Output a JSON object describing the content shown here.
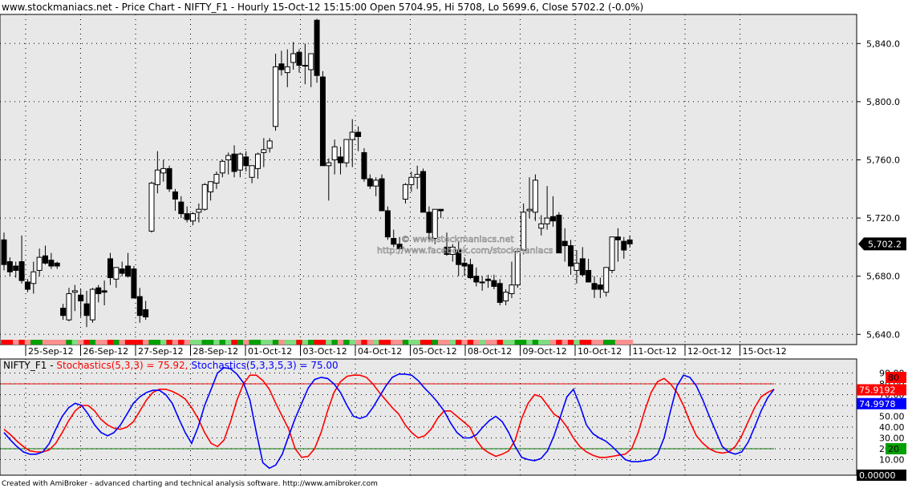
{
  "title": "www.stockmaniacs.net - Price Chart - NIFTY_F1 - Hourly 15-Oct-12 15:15:00 Open 5704.95, Hi 5708, Lo 5699.6, Close 5702.2 (-0.0%)",
  "footer": "Created with AmiBroker - advanced charting and technical analysis software. http://www.amibroker.com",
  "watermark": {
    "line1": "© www.stockmaniacs.net",
    "line2": "http://www.facebook.com/stockmaniacs"
  },
  "colors": {
    "bg": "#e8e8e8",
    "up": "#ffffff",
    "down": "#000000",
    "k_line": "#0000ff",
    "d_line": "#ff0000",
    "overbought": "#ff0000",
    "oversold": "#008000"
  },
  "chart_data": [
    {
      "type": "candlestick",
      "title": "NIFTY_F1 Hourly",
      "ylim": [
        5633,
        5860
      ],
      "y_ticks": [
        5640,
        5680,
        5720,
        5760,
        5800,
        5840
      ],
      "y_tick_labels": [
        "5,640.0",
        "5,680.0",
        "5,720.0",
        "5,760.0",
        "5,800.0",
        "5,840.0"
      ],
      "last_value_label": "5,702.2",
      "last_value": 5702.2,
      "dates": [
        "25-Sep-12",
        "26-Sep-12",
        "27-Sep-12",
        "28-Sep-12",
        "01-Oct-12",
        "03-Oct-12",
        "04-Oct-12",
        "05-Oct-12",
        "08-Oct-12",
        "09-Oct-12",
        "10-Oct-12",
        "11-Oct-12",
        "12-Oct-12",
        "15-Oct-12"
      ],
      "ohlc": [
        [
          5705,
          5710,
          5684,
          5688
        ],
        [
          5690,
          5693,
          5680,
          5683
        ],
        [
          5687,
          5690,
          5679,
          5684
        ],
        [
          5690,
          5708,
          5675,
          5677
        ],
        [
          5676,
          5678,
          5669,
          5671
        ],
        [
          5675,
          5690,
          5668,
          5683
        ],
        [
          5684,
          5699,
          5680,
          5693
        ],
        [
          5694,
          5701,
          5688,
          5689
        ],
        [
          5691,
          5696,
          5685,
          5687
        ],
        [
          5689,
          5690,
          5685,
          5687
        ],
        [
          5658,
          5661,
          5650,
          5653
        ],
        [
          5650,
          5672,
          5649,
          5668
        ],
        [
          5669,
          5674,
          5656,
          5670
        ],
        [
          5667,
          5671,
          5652,
          5663
        ],
        [
          5661,
          5670,
          5645,
          5653
        ],
        [
          5650,
          5672,
          5648,
          5671
        ],
        [
          5672,
          5674,
          5662,
          5668
        ],
        [
          5670,
          5677,
          5660,
          5669
        ],
        [
          5692,
          5696,
          5674,
          5679
        ],
        [
          5678,
          5686,
          5672,
          5686
        ],
        [
          5685,
          5690,
          5680,
          5682
        ],
        [
          5687,
          5696,
          5679,
          5680
        ],
        [
          5685,
          5687,
          5665,
          5665
        ],
        [
          5666,
          5672,
          5648,
          5653
        ],
        [
          5657,
          5663,
          5650,
          5652
        ],
        [
          5711,
          5745,
          5710,
          5744
        ],
        [
          5743,
          5766,
          5737,
          5753
        ],
        [
          5751,
          5760,
          5745,
          5754
        ],
        [
          5754,
          5756,
          5738,
          5740
        ],
        [
          5738,
          5740,
          5725,
          5733
        ],
        [
          5731,
          5735,
          5720,
          5723
        ],
        [
          5723,
          5728,
          5717,
          5719
        ],
        [
          5718,
          5724,
          5715,
          5723
        ],
        [
          5724,
          5730,
          5717,
          5726
        ],
        [
          5726,
          5744,
          5725,
          5743
        ],
        [
          5738,
          5745,
          5732,
          5745
        ],
        [
          5744,
          5752,
          5740,
          5750
        ],
        [
          5751,
          5760,
          5748,
          5759
        ],
        [
          5760,
          5765,
          5750,
          5763
        ],
        [
          5764,
          5770,
          5748,
          5752
        ],
        [
          5753,
          5765,
          5748,
          5764
        ],
        [
          5762,
          5766,
          5752,
          5756
        ],
        [
          5748,
          5755,
          5744,
          5756
        ],
        [
          5754,
          5765,
          5747,
          5764
        ],
        [
          5765,
          5775,
          5755,
          5767
        ],
        [
          5768,
          5775,
          5765,
          5773
        ],
        [
          5783,
          5833,
          5780,
          5824
        ],
        [
          5826,
          5835,
          5818,
          5822
        ],
        [
          5820,
          5836,
          5810,
          5824
        ],
        [
          5827,
          5841,
          5822,
          5833
        ],
        [
          5834,
          5836,
          5820,
          5825
        ],
        [
          5825,
          5840,
          5812,
          5825
        ],
        [
          5822,
          5832,
          5810,
          5833
        ],
        [
          5856,
          5857,
          5813,
          5818
        ],
        [
          5817,
          5821,
          5768,
          5756
        ],
        [
          5756,
          5761,
          5732,
          5758
        ],
        [
          5760,
          5774,
          5750,
          5769
        ],
        [
          5762,
          5769,
          5750,
          5758
        ],
        [
          5758,
          5770,
          5755,
          5774
        ],
        [
          5774,
          5788,
          5755,
          5779
        ],
        [
          5779,
          5783,
          5766,
          5776
        ],
        [
          5765,
          5768,
          5745,
          5747
        ],
        [
          5747,
          5750,
          5740,
          5742
        ],
        [
          5742,
          5748,
          5735,
          5746
        ],
        [
          5747,
          5750,
          5725,
          5725
        ],
        [
          5725,
          5728,
          5705,
          5707
        ],
        [
          5706,
          5712,
          5700,
          5702
        ],
        [
          5702,
          5707,
          5698,
          5699
        ],
        [
          5733,
          5744,
          5730,
          5743
        ],
        [
          5743,
          5752,
          5738,
          5748
        ],
        [
          5748,
          5756,
          5740,
          5750
        ],
        [
          5752,
          5754,
          5724,
          5724
        ],
        [
          5724,
          5728,
          5705,
          5710
        ],
        [
          5706,
          5726,
          5702,
          5726
        ],
        [
          5726,
          5726,
          5720,
          5725
        ],
        [
          5700,
          5710,
          5694,
          5695
        ],
        [
          5695,
          5702,
          5690,
          5700
        ],
        [
          5698,
          5704,
          5680,
          5688
        ],
        [
          5689,
          5693,
          5680,
          5687
        ],
        [
          5688,
          5692,
          5678,
          5679
        ],
        [
          5680,
          5686,
          5673,
          5676
        ],
        [
          5676,
          5680,
          5670,
          5676
        ],
        [
          5678,
          5681,
          5672,
          5677
        ],
        [
          5677,
          5681,
          5671,
          5673
        ],
        [
          5675,
          5678,
          5660,
          5662
        ],
        [
          5663,
          5671,
          5660,
          5669
        ],
        [
          5668,
          5690,
          5665,
          5674
        ],
        [
          5674,
          5697,
          5672,
          5697
        ],
        [
          5698,
          5730,
          5695,
          5724
        ],
        [
          5725,
          5748,
          5720,
          5726
        ],
        [
          5724,
          5750,
          5718,
          5746
        ],
        [
          5713,
          5722,
          5708,
          5716
        ],
        [
          5716,
          5742,
          5712,
          5720
        ],
        [
          5721,
          5735,
          5714,
          5718
        ],
        [
          5722,
          5724,
          5700,
          5696
        ],
        [
          5704,
          5713,
          5690,
          5701
        ],
        [
          5701,
          5705,
          5681,
          5687
        ],
        [
          5684,
          5698,
          5675,
          5689
        ],
        [
          5692,
          5700,
          5680,
          5681
        ],
        [
          5684,
          5692,
          5676,
          5676
        ],
        [
          5675,
          5680,
          5665,
          5671
        ],
        [
          5674,
          5679,
          5665,
          5671
        ],
        [
          5669,
          5685,
          5666,
          5686
        ],
        [
          5684,
          5704,
          5682,
          5707
        ],
        [
          5707,
          5713,
          5690,
          5705
        ],
        [
          5704,
          5707,
          5692,
          5698
        ],
        [
          5704.95,
          5708,
          5699.6,
          5702.2
        ]
      ]
    },
    {
      "type": "line",
      "title": "Stochastics",
      "legend_prefix": "NIFTY_F1 - ",
      "legend_d": "Stochastics(5,3,3) = 75.92,",
      "legend_k": "Stochastics(5,3,3,5,3) = 75.00",
      "ylim": [
        0,
        100
      ],
      "y_tick_labels": [
        "10.00",
        "20.00",
        "30.00",
        "40.00",
        "50.00",
        "60.00",
        "70.00",
        "80.00",
        "90.00"
      ],
      "overbought": 80,
      "oversold": 20,
      "ob_label": "80",
      "os_label": "20",
      "zero_label": "0.00000",
      "last_d_label": "75.9192",
      "last_k_label": "74.9978",
      "series": [
        {
          "name": "Stochastics(5,3,3)",
          "color": "#ff0000",
          "values": [
            38,
            33,
            27,
            22,
            18,
            17,
            17,
            19,
            25,
            35,
            46,
            55,
            60,
            60,
            55,
            47,
            42,
            39,
            38,
            40,
            45,
            55,
            65,
            72,
            75,
            75,
            73,
            70,
            66,
            58,
            48,
            35,
            25,
            22,
            28,
            45,
            65,
            80,
            88,
            88,
            83,
            75,
            62,
            50,
            38,
            20,
            12,
            13,
            20,
            35,
            55,
            72,
            82,
            87,
            88,
            88,
            86,
            80,
            72,
            65,
            58,
            52,
            42,
            35,
            30,
            32,
            38,
            48,
            55,
            55,
            50,
            45,
            40,
            28,
            20,
            16,
            13,
            15,
            18,
            28,
            48,
            62,
            70,
            68,
            60,
            52,
            48,
            40,
            30,
            22,
            17,
            14,
            12,
            12,
            13,
            14,
            15,
            20,
            35,
            55,
            72,
            82,
            85,
            80,
            72,
            60,
            45,
            32,
            25,
            20,
            17,
            16,
            17,
            22,
            32,
            45,
            58,
            68,
            72,
            75
          ]
        },
        {
          "name": "Stochastics(5,3,3,5,3)",
          "color": "#0000ff",
          "values": [
            35,
            28,
            22,
            17,
            15,
            15,
            17,
            25,
            38,
            50,
            58,
            62,
            60,
            52,
            42,
            35,
            32,
            35,
            42,
            52,
            62,
            68,
            72,
            74,
            74,
            70,
            62,
            48,
            35,
            25,
            40,
            60,
            75,
            90,
            95,
            94,
            89,
            81,
            65,
            35,
            7,
            2,
            5,
            15,
            32,
            48,
            62,
            76,
            84,
            86,
            85,
            80,
            72,
            60,
            50,
            48,
            50,
            58,
            68,
            78,
            86,
            89,
            89,
            88,
            83,
            76,
            70,
            63,
            55,
            44,
            35,
            30,
            30,
            33,
            40,
            46,
            50,
            45,
            35,
            22,
            12,
            10,
            9,
            11,
            18,
            32,
            50,
            68,
            75,
            60,
            42,
            34,
            30,
            27,
            22,
            16,
            10,
            8,
            8,
            9,
            10,
            15,
            30,
            55,
            78,
            88,
            86,
            78,
            65,
            50,
            36,
            22,
            17,
            15,
            17,
            26,
            40,
            55,
            67,
            75
          ]
        }
      ]
    }
  ]
}
